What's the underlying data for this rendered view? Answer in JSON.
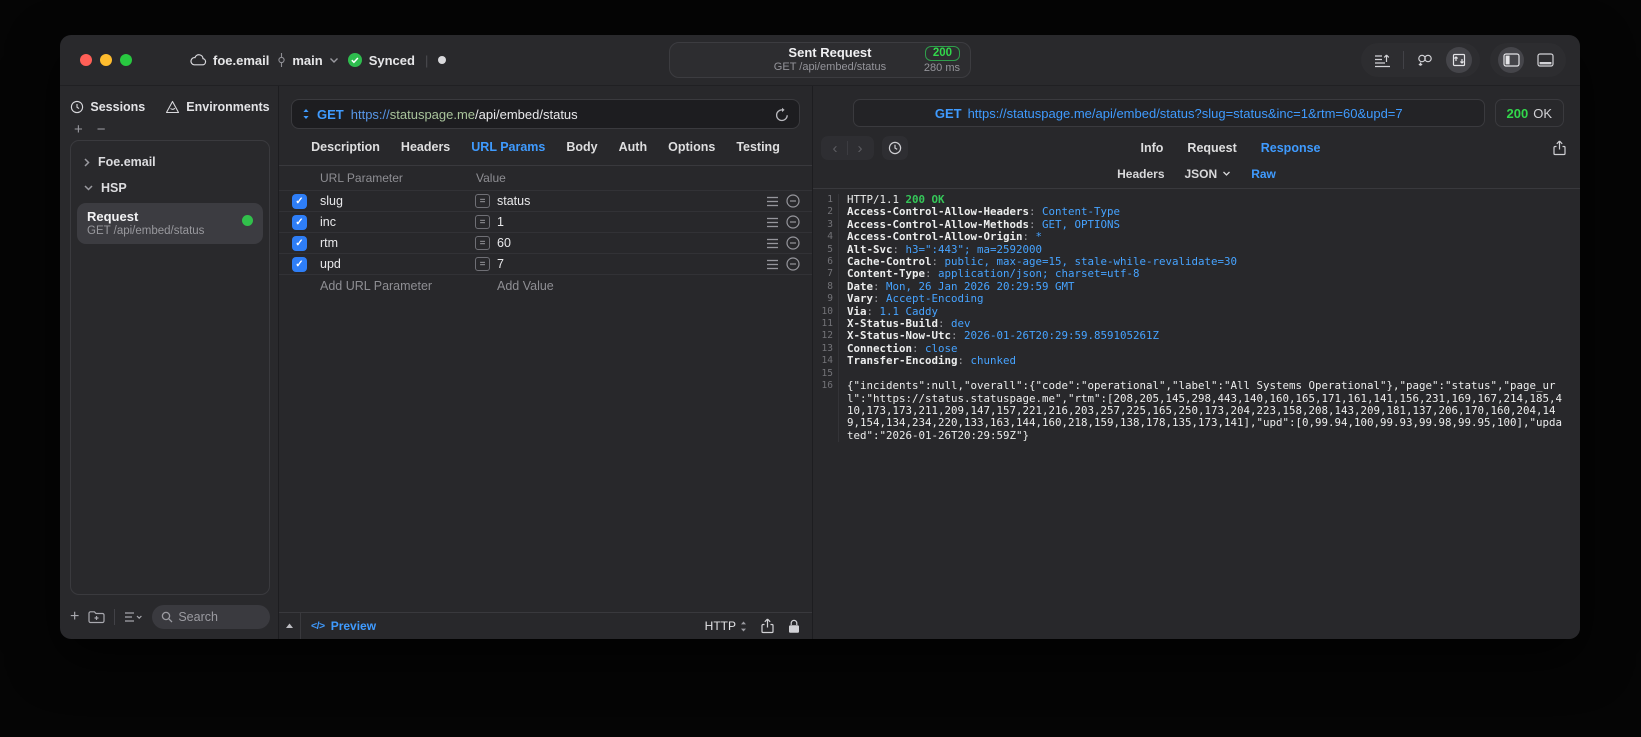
{
  "titlebar": {
    "project": "foe.email",
    "branch": "main",
    "sync_status": "Synced",
    "title": "Sent Request",
    "subtitle": "GET /api/embed/status",
    "status_code": "200",
    "latency": "280 ms"
  },
  "sidebar": {
    "tabs": [
      {
        "label": "Sessions"
      },
      {
        "label": "Environments"
      }
    ],
    "tree": [
      {
        "type": "group",
        "label": "Foe.email",
        "collapsed": true
      },
      {
        "type": "group",
        "label": "HSP",
        "collapsed": false
      },
      {
        "type": "request",
        "title": "Request",
        "subtitle": "GET /api/embed/status",
        "selected": true,
        "status_dot": "#31c04b"
      }
    ],
    "search_placeholder": "Search"
  },
  "request_pane": {
    "url": {
      "method": "GET",
      "scheme": "https://",
      "host": "statuspage.me",
      "path": "/api/embed/status"
    },
    "tabs": [
      {
        "label": "Description"
      },
      {
        "label": "Headers"
      },
      {
        "label": "URL Params",
        "active": true
      },
      {
        "label": "Body"
      },
      {
        "label": "Auth"
      },
      {
        "label": "Options"
      },
      {
        "label": "Testing"
      }
    ],
    "table": {
      "columns": {
        "name": "URL Parameter",
        "value": "Value"
      },
      "params": [
        {
          "enabled": true,
          "name": "slug",
          "value": "status"
        },
        {
          "enabled": true,
          "name": "inc",
          "value": "1"
        },
        {
          "enabled": true,
          "name": "rtm",
          "value": "60"
        },
        {
          "enabled": true,
          "name": "upd",
          "value": "7"
        }
      ],
      "add_row": {
        "name_placeholder": "Add URL Parameter",
        "value_placeholder": "Add Value"
      }
    },
    "bottom_bar": {
      "preview_label": "Preview",
      "protocol": "HTTP"
    }
  },
  "response_pane": {
    "url": {
      "method": "GET",
      "address": "https://statuspage.me/api/embed/status?slug=status&inc=1&rtm=60&upd=7"
    },
    "status": {
      "code": "200",
      "text": "OK"
    },
    "tabs": [
      {
        "label": "Info"
      },
      {
        "label": "Request"
      },
      {
        "label": "Response",
        "active": true
      }
    ],
    "subtabs": [
      {
        "label": "Headers"
      },
      {
        "label": "JSON",
        "dropdown": true
      },
      {
        "label": "Raw",
        "active": true
      }
    ],
    "body": {
      "lines": [
        {
          "n": "1",
          "parts": [
            [
              "w",
              "HTTP/1.1 "
            ],
            [
              "g",
              "200 OK"
            ]
          ]
        },
        {
          "n": "2",
          "parts": [
            [
              "k",
              "Access-Control-Allow-Headers"
            ],
            [
              "p",
              ": "
            ],
            [
              "v",
              "Content-Type"
            ]
          ]
        },
        {
          "n": "3",
          "parts": [
            [
              "k",
              "Access-Control-Allow-Methods"
            ],
            [
              "p",
              ": "
            ],
            [
              "v",
              "GET, OPTIONS"
            ]
          ]
        },
        {
          "n": "4",
          "parts": [
            [
              "k",
              "Access-Control-Allow-Origin"
            ],
            [
              "p",
              ": "
            ],
            [
              "v",
              "*"
            ]
          ]
        },
        {
          "n": "5",
          "parts": [
            [
              "k",
              "Alt-Svc"
            ],
            [
              "p",
              ": "
            ],
            [
              "v",
              "h3=\":443\"; ma=2592000"
            ]
          ]
        },
        {
          "n": "6",
          "parts": [
            [
              "k",
              "Cache-Control"
            ],
            [
              "p",
              ": "
            ],
            [
              "v",
              "public, max-age=15, stale-while-revalidate=30"
            ]
          ]
        },
        {
          "n": "7",
          "parts": [
            [
              "k",
              "Content-Type"
            ],
            [
              "p",
              ": "
            ],
            [
              "v",
              "application/json; charset=utf-8"
            ]
          ]
        },
        {
          "n": "8",
          "parts": [
            [
              "k",
              "Date"
            ],
            [
              "p",
              ": "
            ],
            [
              "v",
              "Mon, 26 Jan 2026 20:29:59 GMT"
            ]
          ]
        },
        {
          "n": "9",
          "parts": [
            [
              "k",
              "Vary"
            ],
            [
              "p",
              ": "
            ],
            [
              "v",
              "Accept-Encoding"
            ]
          ]
        },
        {
          "n": "10",
          "parts": [
            [
              "k",
              "Via"
            ],
            [
              "p",
              ": "
            ],
            [
              "v",
              "1.1 Caddy"
            ]
          ]
        },
        {
          "n": "11",
          "parts": [
            [
              "k",
              "X-Status-Build"
            ],
            [
              "p",
              ": "
            ],
            [
              "v",
              "dev"
            ]
          ]
        },
        {
          "n": "12",
          "parts": [
            [
              "k",
              "X-Status-Now-Utc"
            ],
            [
              "p",
              ": "
            ],
            [
              "v",
              "2026-01-26T20:29:59.859105261Z"
            ]
          ]
        },
        {
          "n": "13",
          "parts": [
            [
              "k",
              "Connection"
            ],
            [
              "p",
              ": "
            ],
            [
              "v",
              "close"
            ]
          ]
        },
        {
          "n": "14",
          "parts": [
            [
              "k",
              "Transfer-Encoding"
            ],
            [
              "p",
              ": "
            ],
            [
              "v",
              "chunked"
            ]
          ]
        },
        {
          "n": "15",
          "parts": []
        },
        {
          "n": "16",
          "parts": [
            [
              "w",
              "{\"incidents\":null,\"overall\":{\"code\":\"operational\",\"label\":\"All Systems Operational\"},\"page\":\"status\",\"page_url\":\"https://status.statuspage.me\",\"rtm\":[208,205,145,298,443,140,160,165,171,161,141,156,231,169,167,214,185,410,173,173,211,209,147,157,221,216,203,257,225,165,250,173,204,223,158,208,143,209,181,137,206,170,160,204,149,154,134,234,220,133,163,144,160,218,159,138,178,135,173,141],\"upd\":[0,99.94,100,99.93,99.98,99.95,100],\"updated\":\"2026-01-26T20:29:59Z\"}"
            ]
          ]
        }
      ]
    }
  },
  "colors": {
    "accent_blue": "#3f9bff",
    "status_green": "#32d74b",
    "traffic_red": "#ff5f57",
    "traffic_yellow": "#febc2e",
    "traffic_green": "#28c840"
  }
}
